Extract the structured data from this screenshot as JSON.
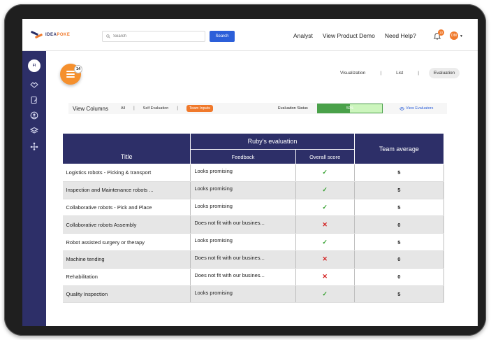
{
  "brand": {
    "name_part1": "IDEA",
    "name_part2": "POKE"
  },
  "topbar": {
    "search_placeholder": "Search",
    "search_button": "Search",
    "links": [
      "Analyst",
      "View Product Demo",
      "Need Help?"
    ],
    "notification_count": "10",
    "avatar_initials": "DM"
  },
  "sidebar": {
    "top_label": "FI"
  },
  "toolbar": {
    "menu_badge": "14",
    "view_tabs": [
      "Visualization",
      "List",
      "Evaluation"
    ],
    "active_view": "Evaluation"
  },
  "columns_bar": {
    "title": "View Columns",
    "options": [
      "All",
      "Self Evaluation",
      "Team Inputs"
    ],
    "active_option": "Team Inputs",
    "status_label": "Evaluation Status",
    "status_percent": 50,
    "status_text": "50%",
    "view_evaluators": "View Evaluators"
  },
  "table": {
    "headers": {
      "title": "Title",
      "group": "Ruby's evaluation",
      "feedback": "Feedback",
      "score": "Overall score",
      "average": "Team average"
    },
    "rows": [
      {
        "title": "Logistics robots - Picking & transport",
        "feedback": "Looks promising",
        "score": "check",
        "average": "5"
      },
      {
        "title": "Inspection and Maintenance robots ...",
        "feedback": "Looks promising",
        "score": "check",
        "average": "5"
      },
      {
        "title": "Collaborative robots - Pick and Place",
        "feedback": "Looks promising",
        "score": "check",
        "average": "5"
      },
      {
        "title": "Collaborative robots Assembly",
        "feedback": "Does not fit with our busines...",
        "score": "cross",
        "average": "0"
      },
      {
        "title": "Robot assisted surgery or therapy",
        "feedback": "Looks promising",
        "score": "check",
        "average": "5"
      },
      {
        "title": "Machine tending",
        "feedback": "Does not fit with our busines...",
        "score": "cross",
        "average": "0"
      },
      {
        "title": "Rehabilitation",
        "feedback": "Does not fit with our busines...",
        "score": "cross",
        "average": "0"
      },
      {
        "title": "Quality Inspection",
        "feedback": "Looks promising",
        "score": "check",
        "average": "5"
      }
    ]
  },
  "colors": {
    "navy": "#2d2f68",
    "accent_orange": "#f0792b",
    "primary_blue": "#2c5fd9",
    "status_green": "#4aa14a",
    "check_green": "#34a02e",
    "cross_red": "#d32020"
  }
}
